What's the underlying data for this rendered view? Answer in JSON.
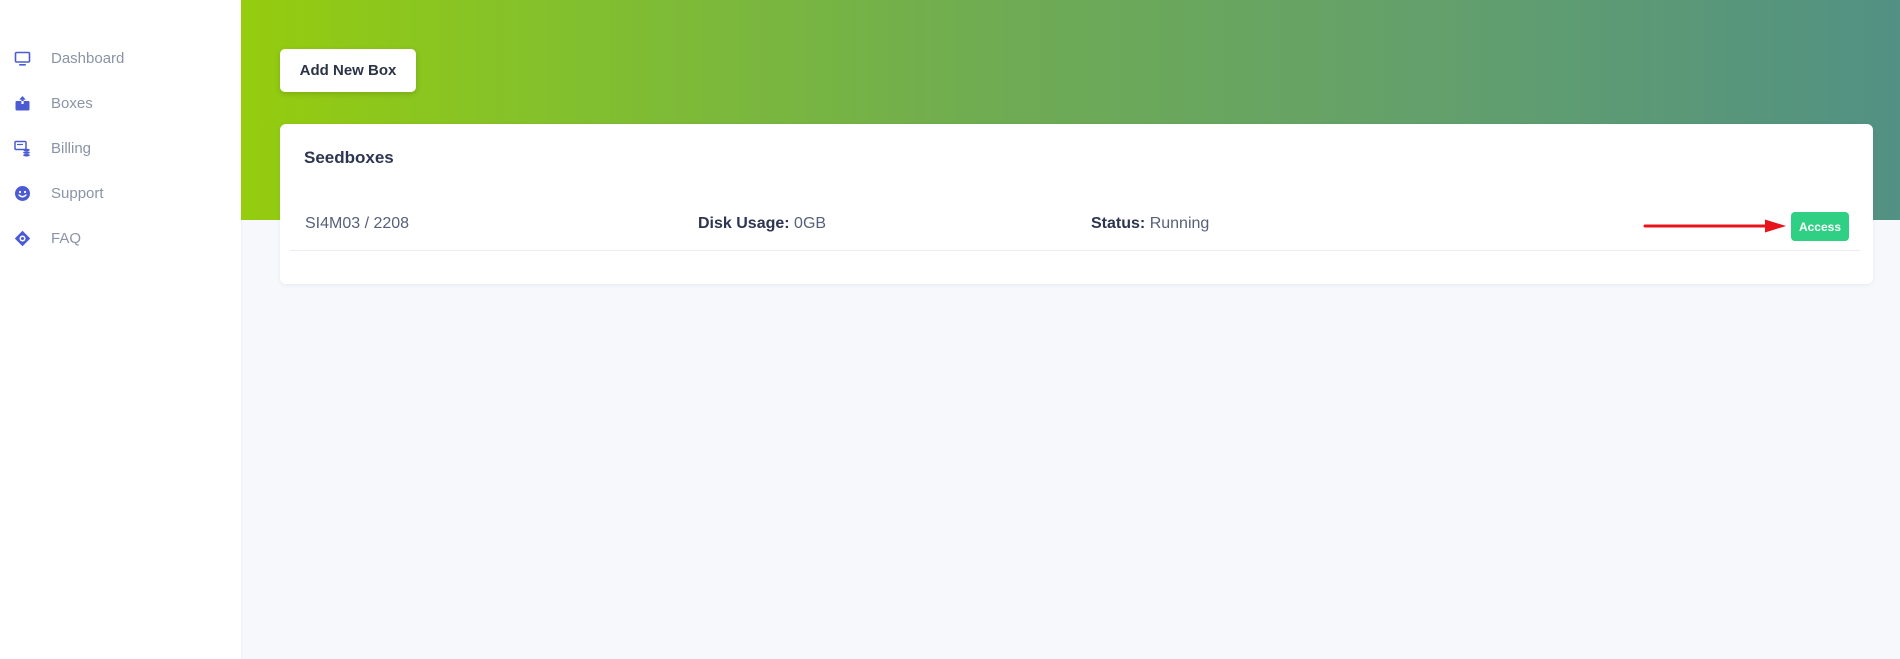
{
  "sidebar": {
    "items": [
      {
        "label": "Dashboard",
        "icon": "monitor-icon"
      },
      {
        "label": "Boxes",
        "icon": "box-icon"
      },
      {
        "label": "Billing",
        "icon": "billing-icon"
      },
      {
        "label": "Support",
        "icon": "smiley-icon"
      },
      {
        "label": "FAQ",
        "icon": "lifebuoy-icon"
      }
    ]
  },
  "header": {
    "add_button_label": "Add New Box"
  },
  "seedboxes": {
    "title": "Seedboxes",
    "rows": [
      {
        "name": "SI4M03 / 2208",
        "disk_label": "Disk Usage:",
        "disk_value": "0GB",
        "status_label": "Status:",
        "status_value": "Running",
        "action_label": "Access"
      }
    ]
  },
  "colors": {
    "icon_accent": "#4b5bd4",
    "access_button": "#2fcf84",
    "annotation_arrow": "#e8141c",
    "gradient_start": "#95cc0e",
    "gradient_end": "#529183"
  }
}
